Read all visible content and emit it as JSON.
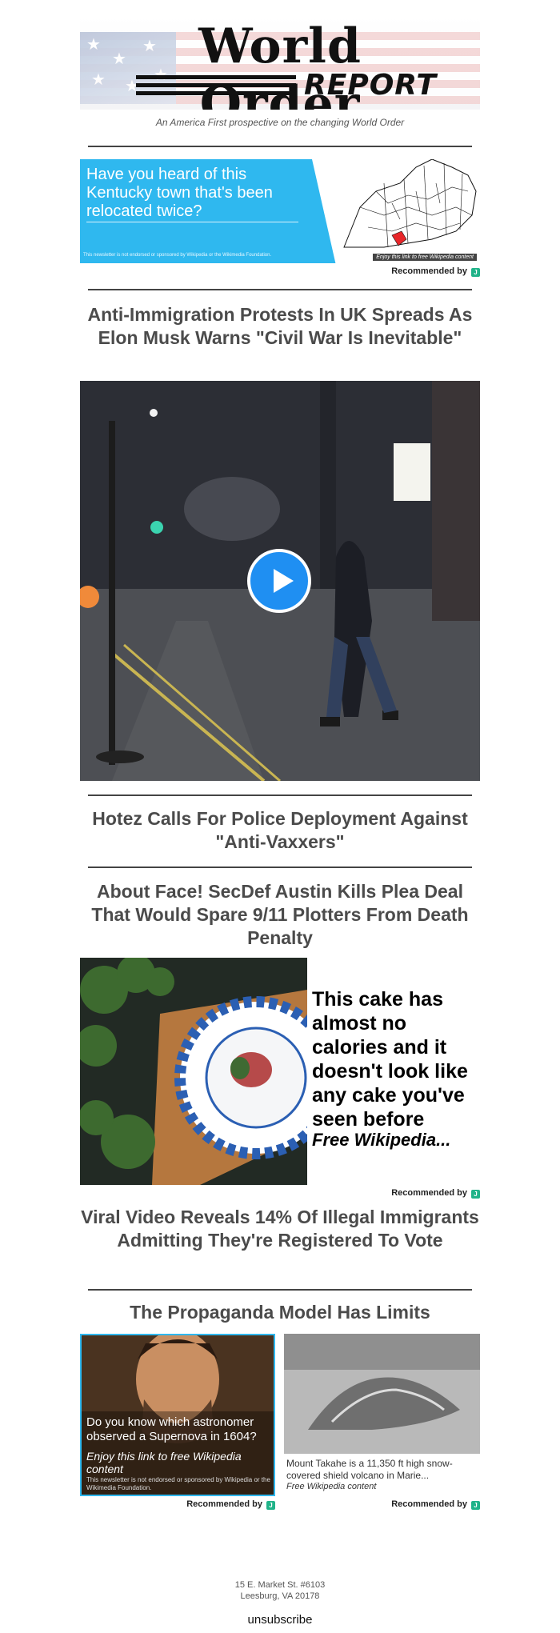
{
  "header": {
    "logo_title": "World Order",
    "logo_report": "REPORT",
    "tagline": "An America First prospective on the changing World Order"
  },
  "ads": {
    "kentucky": {
      "headline": "Have you heard of this Kentucky town that's been relocated twice?",
      "disclaimer": "This newsletter is not endorsed or sponsored by Wikipedia or the Wikimedia Foundation.",
      "caption": "Enjoy this link to free Wikipedia content"
    },
    "cake": {
      "headline": "This cake has almost no calories and it doesn't look like any cake you've seen before",
      "sub": "Free Wikipedia..."
    },
    "astronomer": {
      "headline": "Do you know which astronomer observed a Supernova in 1604?",
      "tag": "Enjoy this link to free Wikipedia content",
      "disclaimer": "This newsletter is not endorsed or sponsored by Wikipedia or the Wikimedia Foundation."
    },
    "volcano": {
      "headline": "Mount Takahe is a 11,350 ft high snow-covered shield volcano in Marie...",
      "tag": "Free Wikipedia content"
    },
    "recommended_label": "Recommended by",
    "badge_glyph": "J"
  },
  "articles": [
    {
      "title": "Anti-Immigration Protests In UK Spreads As Elon Musk Warns \"Civil War Is Inevitable\""
    },
    {
      "title": "Hotez Calls For Police Deployment Against \"Anti-Vaxxers\""
    },
    {
      "title": "About Face! SecDef Austin Kills Plea Deal That Would Spare 9/11 Plotters From Death Penalty"
    },
    {
      "title": "Viral Video Reveals 14% Of Illegal Immigrants Admitting They're Registered To Vote"
    },
    {
      "title": "The Propaganda Model Has Limits"
    }
  ],
  "footer": {
    "address_line1": "15 E. Market St. #6103",
    "address_line2": "Leesburg, VA 20178",
    "unsubscribe": "unsubscribe"
  },
  "colors": {
    "accent_blue": "#2fb8ef",
    "play_blue": "#1f8ff2",
    "badge_green": "#20b389",
    "headline_gray": "#4b4b4b"
  }
}
